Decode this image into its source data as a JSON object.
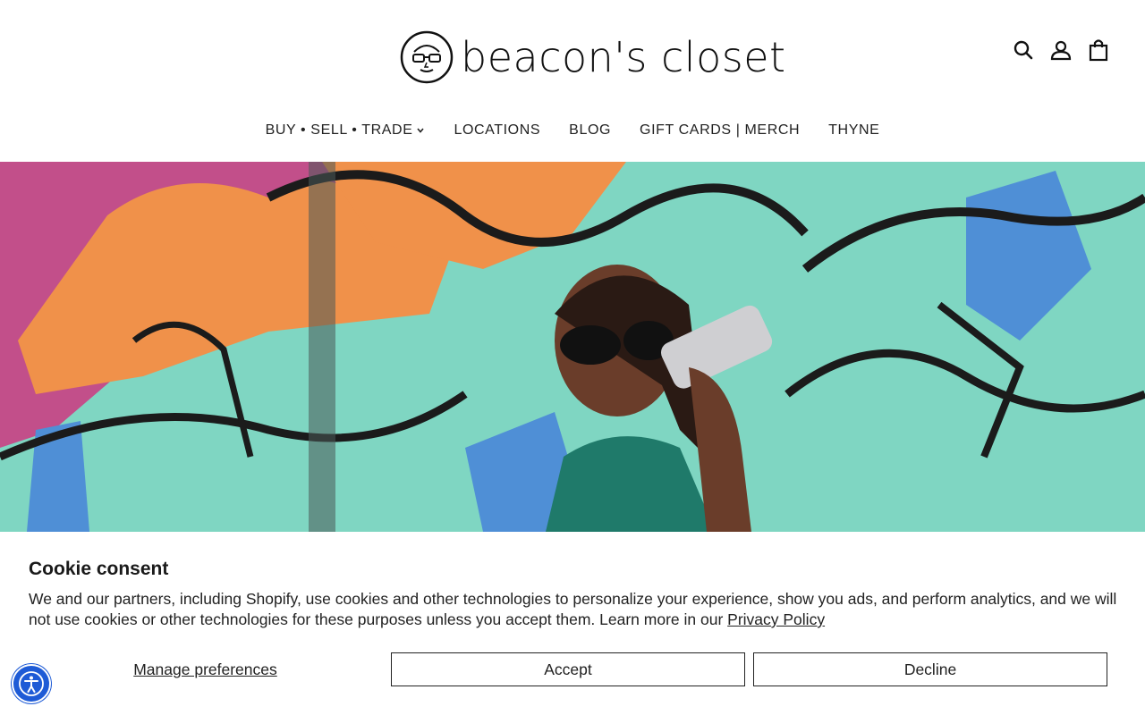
{
  "brand": {
    "name": "beacon's closet"
  },
  "header": {
    "icons": [
      "search-icon",
      "account-icon",
      "cart-icon"
    ]
  },
  "nav": {
    "items": [
      {
        "label": "BUY • SELL • TRADE",
        "has_dropdown": true
      },
      {
        "label": "LOCATIONS"
      },
      {
        "label": "BLOG"
      },
      {
        "label": "GIFT CARDS | MERCH"
      },
      {
        "label": "THYNE"
      }
    ]
  },
  "cookie": {
    "title": "Cookie consent",
    "body": "We and our partners, including Shopify, use cookies and other technologies to personalize your experience, show you ads, and perform analytics, and we will not use cookies or other technologies for these purposes unless you accept them. Learn more in our ",
    "privacy_link": "Privacy Policy",
    "manage_label": "Manage preferences",
    "accept_label": "Accept",
    "decline_label": "Decline"
  },
  "accessibility": {
    "icon": "accessibility-icon"
  },
  "colors": {
    "mural_teal": "#7fd6c2",
    "mural_pink": "#c24f8a",
    "mural_orange": "#f0914a",
    "mural_blue": "#4f8fd6",
    "a11y_blue": "#1e5bd6"
  }
}
